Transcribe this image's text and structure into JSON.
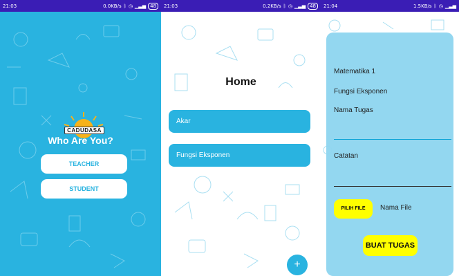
{
  "screens": [
    {
      "status": {
        "time": "21:03",
        "speed": "0.0KB/s",
        "battery": "48"
      },
      "logo_text": "CADUDASA",
      "heading": "Who Are You?",
      "buttons": [
        "TEACHER",
        "STUDENT"
      ]
    },
    {
      "status": {
        "time": "21:03",
        "speed": "0.2KB/s",
        "battery": "48"
      },
      "title": "Home",
      "items": [
        "Akar",
        "Fungsi Eksponen"
      ],
      "fab_label": "+"
    },
    {
      "status": {
        "time": "21:04",
        "speed": "1.5KB/s"
      },
      "subject": "Matematika 1",
      "topic": "Fungsi Eksponen",
      "nama_tugas_label": "Nama Tugas",
      "catatan_label": "Catatan",
      "pilih_file_label": "PILIH FILE",
      "nama_file_label": "Nama File",
      "buat_tugas_label": "BUAT TUGAS"
    }
  ],
  "colors": {
    "primary": "#29b3e0",
    "status_bar": "#3a1db5",
    "card": "#8fd5ef",
    "accent_yellow": "#ffff00"
  },
  "icons": [
    "bluetooth-icon",
    "alarm-icon",
    "signal-icon",
    "battery-icon",
    "add-icon",
    "sun-logo-icon"
  ]
}
